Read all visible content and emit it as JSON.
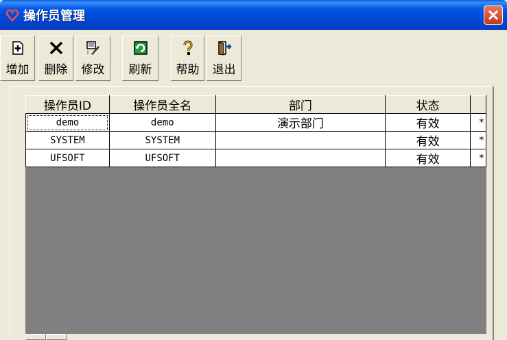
{
  "window": {
    "title": "操作员管理"
  },
  "toolbar": {
    "buttons": [
      {
        "label": "增加",
        "icon": "add-icon"
      },
      {
        "label": "删除",
        "icon": "delete-icon"
      },
      {
        "label": "修改",
        "icon": "edit-icon"
      },
      {
        "label": "刷新",
        "icon": "refresh-icon"
      },
      {
        "label": "帮助",
        "icon": "help-icon"
      },
      {
        "label": "退出",
        "icon": "exit-icon"
      }
    ]
  },
  "table": {
    "columns": [
      "操作员ID",
      "操作员全名",
      "部门",
      "状态",
      ""
    ],
    "rows": [
      [
        "demo",
        "demo",
        "演示部门",
        "有效",
        "*"
      ],
      [
        "SYSTEM",
        "SYSTEM",
        "",
        "有效",
        "*"
      ],
      [
        "UFSOFT",
        "UFSOFT",
        "",
        "有效",
        "*"
      ]
    ]
  },
  "colors": {
    "titlebar": "#0055E5",
    "window_bg": "#ECE9D8",
    "grid_bg": "#808080",
    "close": "#C2381A"
  }
}
